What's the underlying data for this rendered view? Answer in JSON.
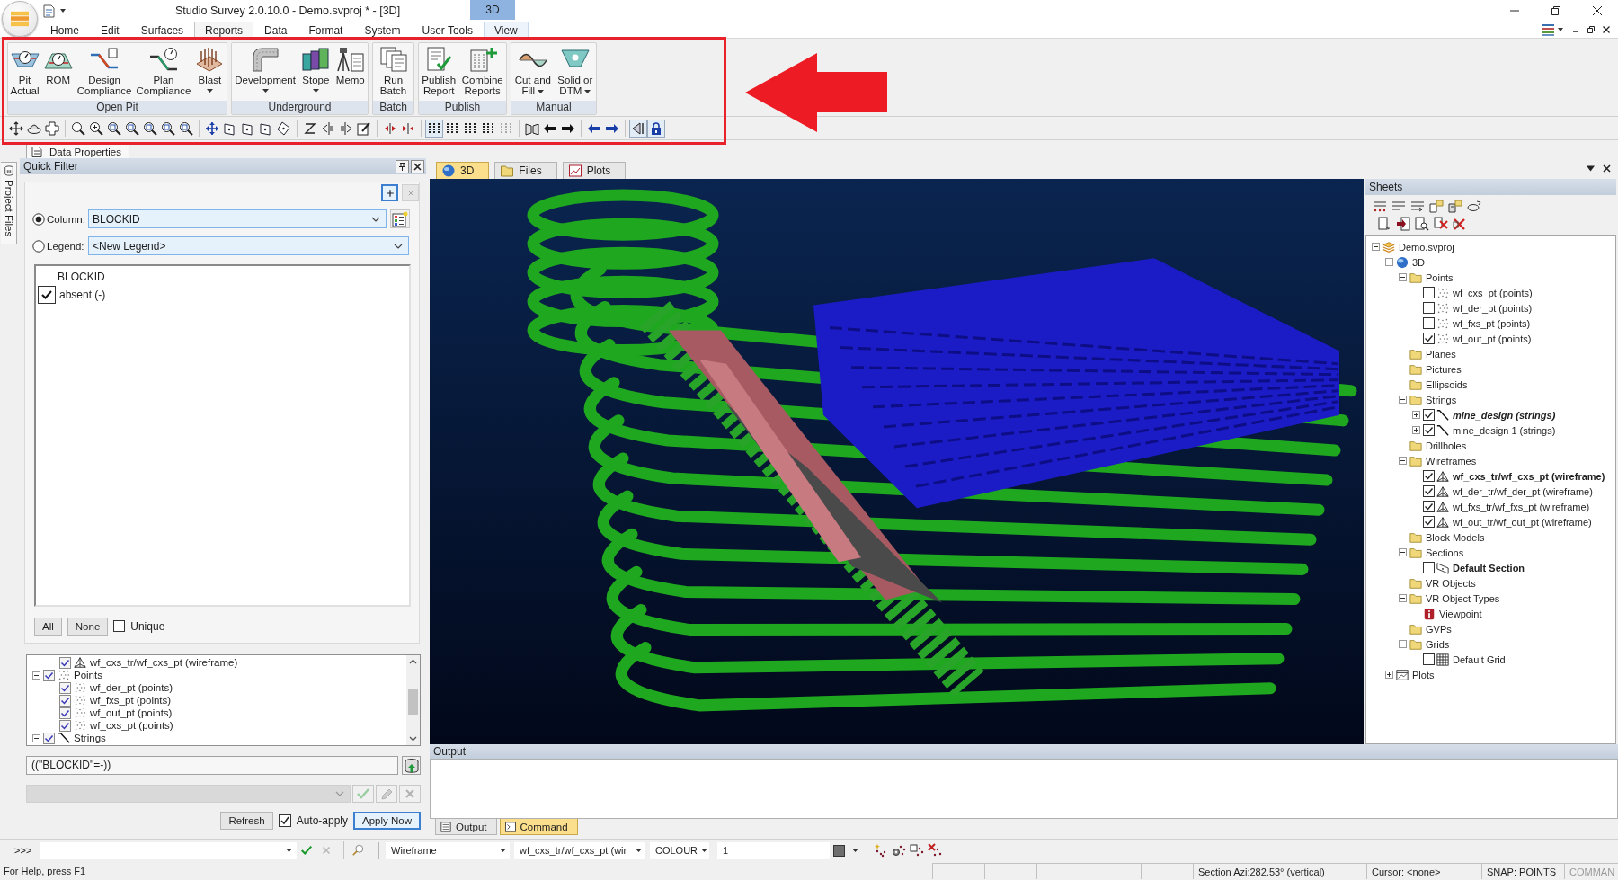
{
  "window": {
    "title": "Studio Survey 2.0.10.0 - Demo.svproj * - [3D]",
    "context_tab": "3D"
  },
  "ribbon_tabs": [
    {
      "label": "Home",
      "selected": false,
      "context": false
    },
    {
      "label": "Edit",
      "selected": false,
      "context": false
    },
    {
      "label": "Surfaces",
      "selected": false,
      "context": false
    },
    {
      "label": "Reports",
      "selected": true,
      "context": false
    },
    {
      "label": "Data",
      "selected": false,
      "context": false
    },
    {
      "label": "Format",
      "selected": false,
      "context": false
    },
    {
      "label": "System",
      "selected": false,
      "context": false
    },
    {
      "label": "User Tools",
      "selected": false,
      "context": false
    },
    {
      "label": "View",
      "selected": false,
      "context": true
    }
  ],
  "ribbon_groups": [
    {
      "label": "Open Pit",
      "buttons": [
        {
          "kind": "pit",
          "label": "Pit\nActual",
          "menu": false
        },
        {
          "kind": "rom",
          "label": "ROM",
          "menu": false
        },
        {
          "kind": "design",
          "label": "Design\nCompliance",
          "menu": false
        },
        {
          "kind": "plan",
          "label": "Plan\nCompliance",
          "menu": false
        },
        {
          "kind": "blast",
          "label": "Blast",
          "menu": true
        }
      ]
    },
    {
      "label": "Underground",
      "buttons": [
        {
          "kind": "development",
          "label": "Development",
          "menu": true
        },
        {
          "kind": "stope",
          "label": "Stope",
          "menu": true
        },
        {
          "kind": "memo",
          "label": "Memo",
          "menu": false
        }
      ]
    },
    {
      "label": "Batch",
      "buttons": [
        {
          "kind": "batch",
          "label": "Run\nBatch",
          "menu": false
        }
      ]
    },
    {
      "label": "Publish",
      "buttons": [
        {
          "kind": "publish",
          "label": "Publish\nReport",
          "menu": false
        },
        {
          "kind": "combine",
          "label": "Combine\nReports",
          "menu": false
        }
      ]
    },
    {
      "label": "Manual",
      "buttons": [
        {
          "kind": "cutfill",
          "label": "Cut and\nFill",
          "menu": true
        },
        {
          "kind": "solid",
          "label": "Solid or\nDTM",
          "menu": true
        }
      ]
    }
  ],
  "view_toolbar": [
    [
      {
        "kind": "pan",
        "pressed": false,
        "disabled": false
      },
      {
        "kind": "orbit",
        "pressed": false,
        "disabled": false
      },
      {
        "kind": "fit",
        "pressed": false,
        "disabled": false
      }
    ],
    [
      {
        "kind": "zoom",
        "pressed": false,
        "disabled": false
      },
      {
        "kind": "zoomplus",
        "pressed": false,
        "disabled": false
      },
      {
        "kind": "zoomframe",
        "pressed": false,
        "disabled": false
      },
      {
        "kind": "zoomframe",
        "pressed": false,
        "disabled": false
      },
      {
        "kind": "zoomframe",
        "pressed": false,
        "disabled": false
      },
      {
        "kind": "zoomframe",
        "pressed": false,
        "disabled": false
      },
      {
        "kind": "zoomframe",
        "pressed": false,
        "disabled": false
      }
    ],
    [
      {
        "kind": "move",
        "pressed": false,
        "disabled": false
      },
      {
        "kind": "plane",
        "pressed": false,
        "disabled": false
      },
      {
        "kind": "plane",
        "pressed": false,
        "disabled": false
      },
      {
        "kind": "plane",
        "pressed": false,
        "disabled": false
      },
      {
        "kind": "slant",
        "pressed": false,
        "disabled": false
      }
    ],
    [
      {
        "kind": "axis",
        "pressed": false,
        "disabled": false
      },
      {
        "kind": "barleft",
        "pressed": false,
        "disabled": false
      },
      {
        "kind": "barright",
        "pressed": false,
        "disabled": false
      },
      {
        "kind": "edit",
        "pressed": false,
        "disabled": false
      }
    ],
    [
      {
        "kind": "spread",
        "pressed": false,
        "disabled": false
      },
      {
        "kind": "squeeze",
        "pressed": false,
        "disabled": false
      }
    ],
    [
      {
        "kind": "bars",
        "pressed": true,
        "disabled": false
      },
      {
        "kind": "bars",
        "pressed": false,
        "disabled": false
      },
      {
        "kind": "bars",
        "pressed": false,
        "disabled": false
      },
      {
        "kind": "bars",
        "pressed": false,
        "disabled": false
      },
      {
        "kind": "bars",
        "pressed": false,
        "disabled": true
      }
    ],
    [
      {
        "kind": "flip",
        "pressed": false,
        "disabled": false
      },
      {
        "kind": "left",
        "pressed": false,
        "disabled": false
      },
      {
        "kind": "right",
        "pressed": false,
        "disabled": false
      }
    ],
    [
      {
        "kind": "prev",
        "pressed": false,
        "disabled": false
      },
      {
        "kind": "next",
        "pressed": false,
        "disabled": false
      }
    ],
    [
      {
        "kind": "perspective",
        "pressed": true,
        "disabled": false
      },
      {
        "kind": "lock",
        "pressed": true,
        "disabled": false
      }
    ]
  ],
  "annotation": {
    "frame": true,
    "arrow": true
  },
  "panel_tab": {
    "label": "Data Properties"
  },
  "side_tab": {
    "label": "Project Files"
  },
  "quick_filter": {
    "title": "Quick Filter",
    "filter_buttons": [
      {
        "kind": "add",
        "disabled": false
      },
      {
        "kind": "remove",
        "disabled": true
      }
    ],
    "source": [
      {
        "kind": "column",
        "label": "Column:",
        "selected": true,
        "value": "BLOCKID"
      },
      {
        "kind": "legend",
        "label": "Legend:",
        "selected": false,
        "value": "<New Legend>"
      }
    ],
    "values": {
      "heading": "BLOCKID",
      "items": [
        {
          "label": "absent (-)",
          "checked": true
        }
      ]
    },
    "select_buttons": [
      "All",
      "None"
    ],
    "unique": {
      "label": "Unique",
      "checked": false
    },
    "layers": [
      {
        "children": [
          {
            "kind": "wireframe",
            "label": "wf_cxs_tr/wf_cxs_pt (wireframe)",
            "checked": true
          }
        ]
      },
      {
        "kind": "points",
        "label": "Points",
        "checked": true,
        "expanded": true,
        "children": [
          {
            "kind": "points",
            "label": "wf_der_pt (points)",
            "checked": true
          },
          {
            "kind": "points",
            "label": "wf_fxs_pt (points)",
            "checked": true
          },
          {
            "kind": "points",
            "label": "wf_out_pt (points)",
            "checked": true
          },
          {
            "kind": "points",
            "label": "wf_cxs_pt (points)",
            "checked": true
          }
        ]
      },
      {
        "kind": "string",
        "label": "Strings",
        "checked": true,
        "expanded": true
      }
    ],
    "expression": "((\"BLOCKID\"=-))",
    "saved_filter": {
      "disabled": true
    },
    "edit_buttons": [
      {
        "kind": "accept",
        "disabled": true
      },
      {
        "kind": "edit",
        "disabled": true
      },
      {
        "kind": "delete",
        "disabled": true
      }
    ],
    "refresh": "Refresh",
    "auto_apply": {
      "label": "Auto-apply",
      "checked": true
    },
    "apply": "Apply Now"
  },
  "view_tabs": [
    {
      "kind": "globe",
      "label": "3D",
      "selected": true
    },
    {
      "kind": "folder",
      "label": "Files",
      "selected": false
    },
    {
      "kind": "plot",
      "label": "Plots",
      "selected": false
    }
  ],
  "sheets": {
    "title": "Sheets",
    "tree": [
      {
        "kind": "project",
        "label": "Demo.svproj",
        "expanded": true,
        "children": [
          {
            "kind": "globe",
            "label": "3D",
            "expanded": true,
            "children": [
              {
                "kind": "folder",
                "label": "Points",
                "expanded": true,
                "children": [
                  {
                    "kind": "points",
                    "label": "wf_cxs_pt (points)",
                    "checked": false,
                    "bold": false,
                    "italic": false
                  },
                  {
                    "kind": "points",
                    "label": "wf_der_pt (points)",
                    "checked": false,
                    "bold": false,
                    "italic": false
                  },
                  {
                    "kind": "points",
                    "label": "wf_fxs_pt (points)",
                    "checked": false,
                    "bold": false,
                    "italic": false
                  },
                  {
                    "kind": "points",
                    "label": "wf_out_pt (points)",
                    "checked": true,
                    "bold": false,
                    "italic": false
                  }
                ]
              },
              {
                "kind": "folder",
                "label": "Planes"
              },
              {
                "kind": "folder",
                "label": "Pictures"
              },
              {
                "kind": "folder",
                "label": "Ellipsoids"
              },
              {
                "kind": "folder",
                "label": "Strings",
                "expanded": true,
                "children": [
                  {
                    "kind": "string",
                    "label": "mine_design (strings)",
                    "checked": true,
                    "expanded": false,
                    "bold": true,
                    "italic": true
                  },
                  {
                    "kind": "string",
                    "label": "mine_design 1 (strings)",
                    "checked": true,
                    "expanded": false,
                    "bold": false,
                    "italic": false
                  }
                ]
              },
              {
                "kind": "folder",
                "label": "Drillholes"
              },
              {
                "kind": "folder",
                "label": "Wireframes",
                "expanded": true,
                "children": [
                  {
                    "kind": "wireframe",
                    "label": "wf_cxs_tr/wf_cxs_pt (wireframe)",
                    "checked": true,
                    "bold": true,
                    "italic": false
                  },
                  {
                    "kind": "wireframe",
                    "label": "wf_der_tr/wf_der_pt (wireframe)",
                    "checked": true,
                    "bold": false,
                    "italic": false
                  },
                  {
                    "kind": "wireframe",
                    "label": "wf_fxs_tr/wf_fxs_pt (wireframe)",
                    "checked": true,
                    "bold": false,
                    "italic": false
                  },
                  {
                    "kind": "wireframe",
                    "label": "wf_out_tr/wf_out_pt (wireframe)",
                    "checked": true,
                    "bold": false,
                    "italic": false
                  }
                ]
              },
              {
                "kind": "folder",
                "label": "Block Models"
              },
              {
                "kind": "folder",
                "label": "Sections",
                "expanded": true,
                "children": [
                  {
                    "kind": "section",
                    "label": "Default Section",
                    "checked": false,
                    "bold": true,
                    "italic": false
                  }
                ]
              },
              {
                "kind": "folder",
                "label": "VR Objects"
              },
              {
                "kind": "folder",
                "label": "VR Object Types",
                "expanded": true,
                "children": [
                  {
                    "kind": "viewpoint",
                    "label": "Viewpoint"
                  }
                ]
              },
              {
                "kind": "folder",
                "label": "GVPs"
              },
              {
                "kind": "folder",
                "label": "Grids",
                "expanded": true,
                "children": [
                  {
                    "kind": "grid",
                    "label": "Default Grid",
                    "checked": false,
                    "bold": false,
                    "italic": false
                  }
                ]
              }
            ]
          },
          {
            "kind": "plots",
            "label": "Plots",
            "expanded": false
          }
        ]
      }
    ]
  },
  "output": {
    "title": "Output",
    "tabs": [
      {
        "kind": "list",
        "label": "Output",
        "selected": false
      },
      {
        "kind": "terminal",
        "label": "Command",
        "selected": true
      }
    ]
  },
  "command_bar": {
    "prompt": "!>>>",
    "actions": [
      {
        "kind": "accept",
        "disabled": false
      },
      {
        "kind": "cancel",
        "disabled": true
      },
      {
        "kind": "search",
        "disabled": false
      }
    ],
    "layer_type": "Wireframe",
    "layer": "wf_cxs_tr/wf_cxs_pt (wir",
    "attribute": "COLOUR",
    "value": "1"
  },
  "status_bar": {
    "help": "For Help, press F1",
    "panes": [
      {
        "text": "Section Azi:282.53° (vertical)",
        "disabled": false
      },
      {
        "text": "Cursor: <none>",
        "disabled": false
      },
      {
        "text": "SNAP: POINTS",
        "disabled": false
      },
      {
        "text": "COMMAN",
        "disabled": true
      }
    ]
  }
}
